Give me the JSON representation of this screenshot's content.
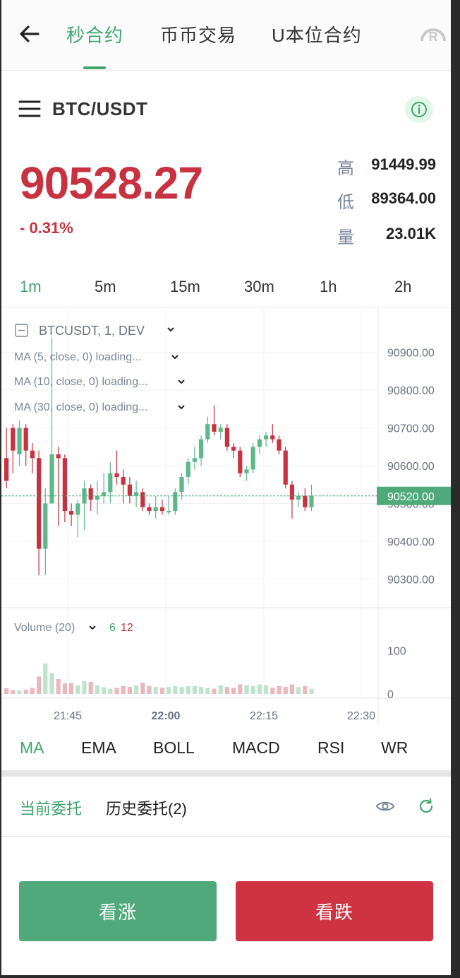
{
  "nav": {
    "tabs": [
      {
        "label": "秒合约",
        "active": true
      },
      {
        "label": "币币交易",
        "active": false
      },
      {
        "label": "U本位合约",
        "active": false
      }
    ],
    "logo_letter": "R"
  },
  "pair": {
    "name": "BTC/USDT"
  },
  "ticker": {
    "price": "90528.27",
    "change": "- 0.31%",
    "high_label": "高",
    "high_value": "91449.99",
    "low_label": "低",
    "low_value": "89364.00",
    "vol_label": "量",
    "vol_value": "23.01K"
  },
  "intervals": [
    {
      "label": "1m",
      "active": true
    },
    {
      "label": "5m",
      "active": false
    },
    {
      "label": "15m",
      "active": false
    },
    {
      "label": "30m",
      "active": false
    },
    {
      "label": "1h",
      "active": false
    },
    {
      "label": "2h",
      "active": false
    }
  ],
  "legend": {
    "symbol": "BTCUSDT, 1, DEV",
    "ma5": "MA (5, close, 0) loading...",
    "ma10": "MA (10, close, 0) loading...",
    "ma30": "MA (30, close, 0) loading...",
    "volume": "Volume (20)",
    "vol_up": "6",
    "vol_down": "12"
  },
  "chart_data": {
    "type": "candlestick",
    "y_ticks": [
      "90900.00",
      "90800.00",
      "90700.00",
      "90600.00",
      "90500.00",
      "90400.00",
      "90300.00"
    ],
    "y_range": [
      90250,
      90980
    ],
    "current_price_label": "90520.00",
    "current_price": 90520,
    "x_ticks": [
      "21:45",
      "22:00",
      "22:15",
      "22:30"
    ],
    "vol_ticks": [
      "100",
      "0"
    ],
    "vol_range": [
      0,
      130
    ],
    "colors": {
      "up": "#5fb88a",
      "down": "#c8313f",
      "vol_up": "#bfe3cf",
      "vol_down": "#eab7bf"
    },
    "candles": [
      [
        90620,
        90560,
        90700,
        90540,
        13
      ],
      [
        90700,
        90640,
        90710,
        90580,
        9
      ],
      [
        90630,
        90700,
        90720,
        90600,
        8
      ],
      [
        90700,
        90640,
        90710,
        90600,
        10
      ],
      [
        90640,
        90620,
        90660,
        90580,
        14
      ],
      [
        90620,
        90380,
        90640,
        90310,
        40
      ],
      [
        90380,
        90500,
        90540,
        90310,
        70
      ],
      [
        90500,
        90630,
        90940,
        90500,
        48
      ],
      [
        90630,
        90620,
        90650,
        90440,
        34
      ],
      [
        90620,
        90480,
        90630,
        90450,
        24
      ],
      [
        90480,
        90470,
        90500,
        90440,
        25
      ],
      [
        90470,
        90500,
        90510,
        90410,
        20
      ],
      [
        90500,
        90540,
        90560,
        90430,
        30
      ],
      [
        90540,
        90510,
        90550,
        90480,
        28
      ],
      [
        90510,
        90520,
        90560,
        90470,
        20
      ],
      [
        90520,
        90530,
        90580,
        90500,
        15
      ],
      [
        90530,
        90580,
        90610,
        90500,
        12
      ],
      [
        90580,
        90570,
        90640,
        90550,
        14
      ],
      [
        90570,
        90550,
        90590,
        90500,
        18
      ],
      [
        90550,
        90520,
        90570,
        90500,
        16
      ],
      [
        90520,
        90530,
        90560,
        90490,
        20
      ],
      [
        90530,
        90490,
        90540,
        90480,
        26
      ],
      [
        90490,
        90480,
        90500,
        90470,
        18
      ],
      [
        90480,
        90490,
        90520,
        90460,
        16
      ],
      [
        90490,
        90480,
        90510,
        90470,
        14
      ],
      [
        90480,
        90480,
        90520,
        90470,
        16
      ],
      [
        90480,
        90530,
        90540,
        90470,
        18
      ],
      [
        90530,
        90570,
        90580,
        90510,
        16
      ],
      [
        90570,
        90610,
        90620,
        90550,
        18
      ],
      [
        90610,
        90620,
        90650,
        90590,
        18
      ],
      [
        90620,
        90670,
        90680,
        90600,
        16
      ],
      [
        90670,
        90710,
        90730,
        90660,
        14
      ],
      [
        90710,
        90690,
        90760,
        90680,
        12
      ],
      [
        90690,
        90700,
        90710,
        90670,
        20
      ],
      [
        90700,
        90650,
        90710,
        90640,
        16
      ],
      [
        90650,
        90640,
        90660,
        90620,
        14
      ],
      [
        90640,
        90580,
        90650,
        90570,
        22
      ],
      [
        90580,
        90590,
        90600,
        90560,
        20
      ],
      [
        90590,
        90650,
        90660,
        90580,
        18
      ],
      [
        90650,
        90670,
        90680,
        90630,
        22
      ],
      [
        90670,
        90680,
        90690,
        90650,
        20
      ],
      [
        90680,
        90670,
        90710,
        90660,
        14
      ],
      [
        90670,
        90640,
        90680,
        90630,
        18
      ],
      [
        90640,
        90550,
        90650,
        90540,
        16
      ],
      [
        90550,
        90510,
        90560,
        90460,
        22
      ],
      [
        90510,
        90520,
        90530,
        90490,
        16
      ],
      [
        90520,
        90490,
        90540,
        90480,
        18
      ],
      [
        90490,
        90520,
        90550,
        90480,
        12
      ]
    ]
  },
  "indicators": [
    {
      "label": "MA",
      "active": true
    },
    {
      "label": "EMA",
      "active": false
    },
    {
      "label": "BOLL",
      "active": false
    },
    {
      "label": "MACD",
      "active": false
    },
    {
      "label": "RSI",
      "active": false
    },
    {
      "label": "WR",
      "active": false
    }
  ],
  "orders": {
    "current": "当前委托",
    "history": "历史委托(2)"
  },
  "actions": {
    "up": "看涨",
    "down": "看跌"
  }
}
